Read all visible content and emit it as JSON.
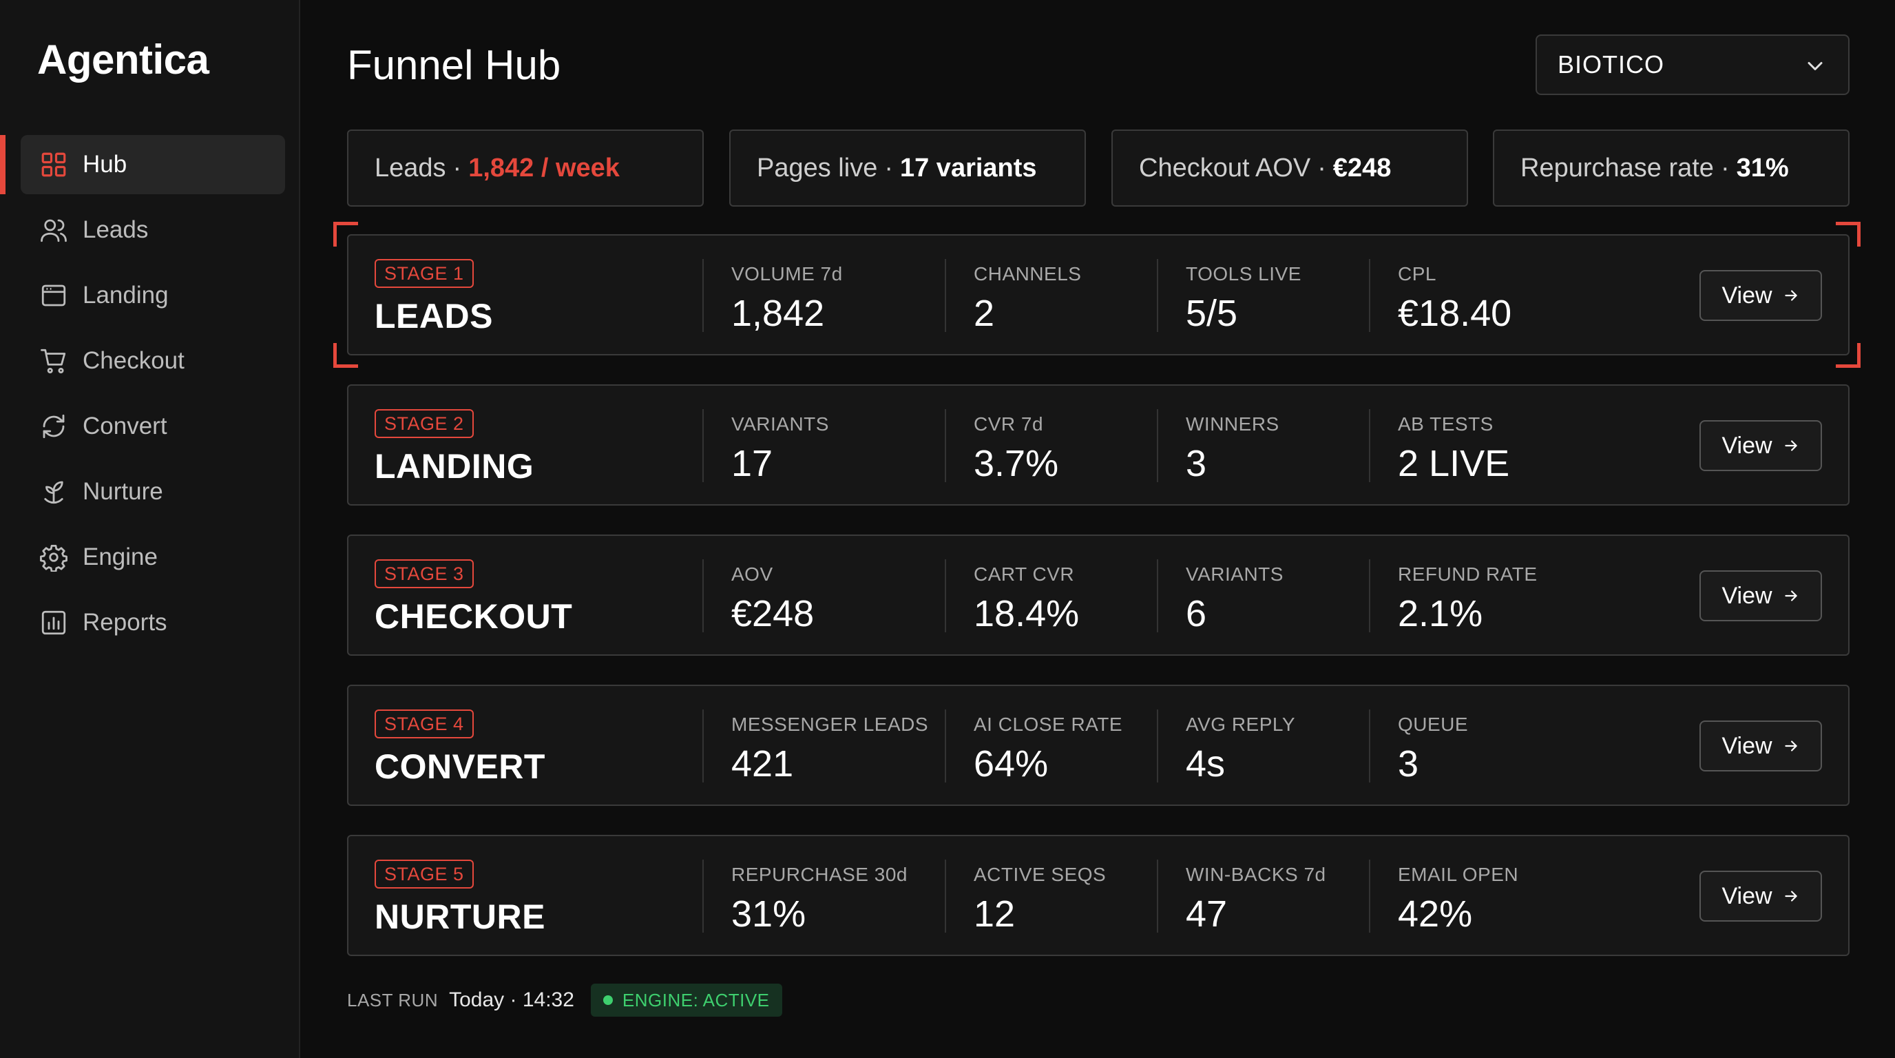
{
  "app": {
    "brand": "Agentica"
  },
  "sidebar": {
    "items": [
      {
        "label": "Hub",
        "icon": "grid-icon",
        "active": true
      },
      {
        "label": "Leads",
        "icon": "users-icon",
        "active": false
      },
      {
        "label": "Landing",
        "icon": "browser-window-icon",
        "active": false
      },
      {
        "label": "Checkout",
        "icon": "cart-icon",
        "active": false
      },
      {
        "label": "Convert",
        "icon": "refresh-icon",
        "active": false
      },
      {
        "label": "Nurture",
        "icon": "sprout-icon",
        "active": false
      },
      {
        "label": "Engine",
        "icon": "gear-icon",
        "active": false
      },
      {
        "label": "Reports",
        "icon": "bar-chart-icon",
        "active": false
      }
    ]
  },
  "header": {
    "title": "Funnel Hub",
    "account_select": {
      "value": "BIOTICO"
    }
  },
  "kpis": [
    {
      "label": "Leads",
      "sep": "·",
      "value": "1,842 / week",
      "accent": true
    },
    {
      "label": "Pages live",
      "sep": "·",
      "value": "17 variants",
      "accent": false
    },
    {
      "label": "Checkout AOV",
      "sep": "·",
      "value": "€248",
      "accent": false
    },
    {
      "label": "Repurchase rate",
      "sep": "·",
      "value": "31%",
      "accent": false
    }
  ],
  "stages": [
    {
      "badge": "STAGE 1",
      "name": "LEADS",
      "focused": true,
      "metrics": [
        {
          "label": "VOLUME 7d",
          "value": "1,842"
        },
        {
          "label": "CHANNELS",
          "value": "2"
        },
        {
          "label": "TOOLS LIVE",
          "value": "5/5"
        },
        {
          "label": "CPL",
          "value": "€18.40"
        }
      ],
      "action": "View"
    },
    {
      "badge": "STAGE 2",
      "name": "LANDING",
      "focused": false,
      "metrics": [
        {
          "label": "VARIANTS",
          "value": "17"
        },
        {
          "label": "CVR 7d",
          "value": "3.7%"
        },
        {
          "label": "WINNERS",
          "value": "3"
        },
        {
          "label": "AB TESTS",
          "value": "2 LIVE"
        }
      ],
      "action": "View"
    },
    {
      "badge": "STAGE 3",
      "name": "CHECKOUT",
      "focused": false,
      "metrics": [
        {
          "label": "AOV",
          "value": "€248"
        },
        {
          "label": "CART CVR",
          "value": "18.4%"
        },
        {
          "label": "VARIANTS",
          "value": "6"
        },
        {
          "label": "REFUND RATE",
          "value": "2.1%"
        }
      ],
      "action": "View"
    },
    {
      "badge": "STAGE 4",
      "name": "CONVERT",
      "focused": false,
      "metrics": [
        {
          "label": "MESSENGER LEADS",
          "value": "421"
        },
        {
          "label": "AI CLOSE RATE",
          "value": "64%"
        },
        {
          "label": "AVG REPLY",
          "value": "4s"
        },
        {
          "label": "QUEUE",
          "value": "3"
        }
      ],
      "action": "View"
    },
    {
      "badge": "STAGE 5",
      "name": "NURTURE",
      "focused": false,
      "metrics": [
        {
          "label": "REPURCHASE 30d",
          "value": "31%"
        },
        {
          "label": "ACTIVE SEQS",
          "value": "12"
        },
        {
          "label": "WIN-BACKS 7d",
          "value": "47"
        },
        {
          "label": "EMAIL OPEN",
          "value": "42%"
        }
      ],
      "action": "View"
    }
  ],
  "footer": {
    "last_run_label": "LAST RUN",
    "last_run_value": "Today · 14:32",
    "engine_status": "ENGINE: ACTIVE"
  },
  "colors": {
    "accent": "#e5483c",
    "status_active": "#3ecf6e",
    "background": "#0d0d0d",
    "panel": "#161616"
  }
}
